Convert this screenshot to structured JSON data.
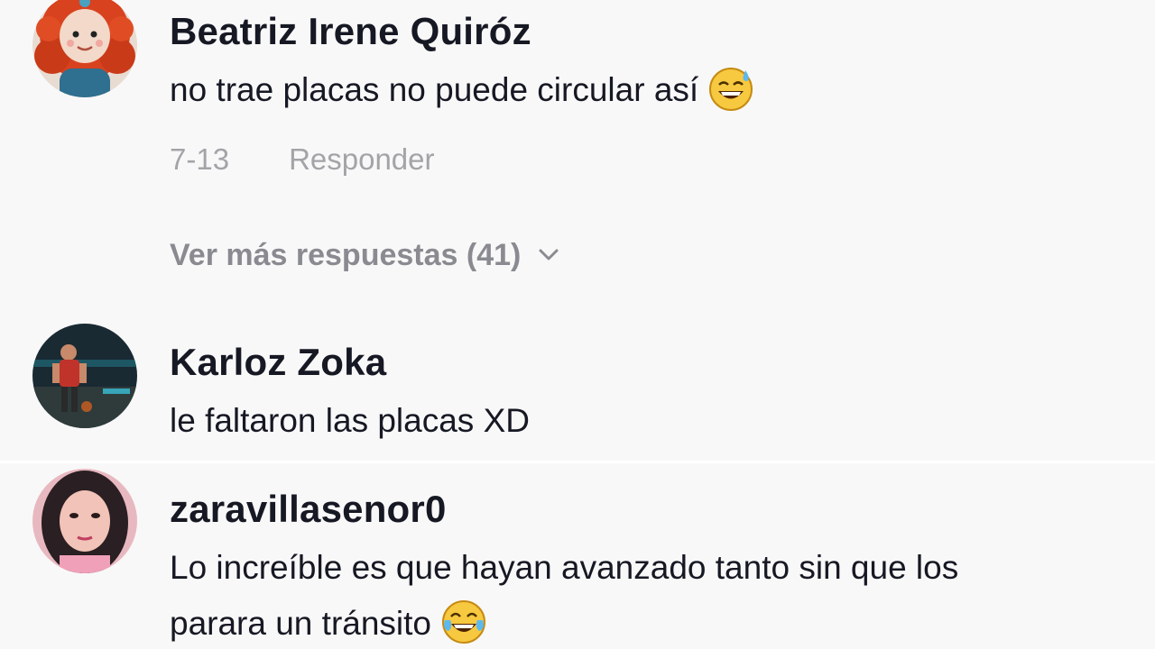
{
  "comments": [
    {
      "username": "Beatriz Irene Quiróz",
      "text": "no trae placas no puede circular así",
      "emoji": "sweat-smile-emoji",
      "date": "7-13",
      "reply_label": "Responder",
      "more_replies_label": "Ver más respuestas (41)",
      "avatar": "avatar-red-hair-doll"
    },
    {
      "username": "Karloz Zoka",
      "text": "le faltaron las placas XD",
      "avatar": "avatar-game-character"
    },
    {
      "username": "zaravillasenor0",
      "text_line1": "Lo increíble es que hayan avanzado tanto sin que los",
      "text_line2": "parara un tránsito",
      "emoji": "tears-of-joy-emoji",
      "avatar": "avatar-woman-photo"
    }
  ]
}
